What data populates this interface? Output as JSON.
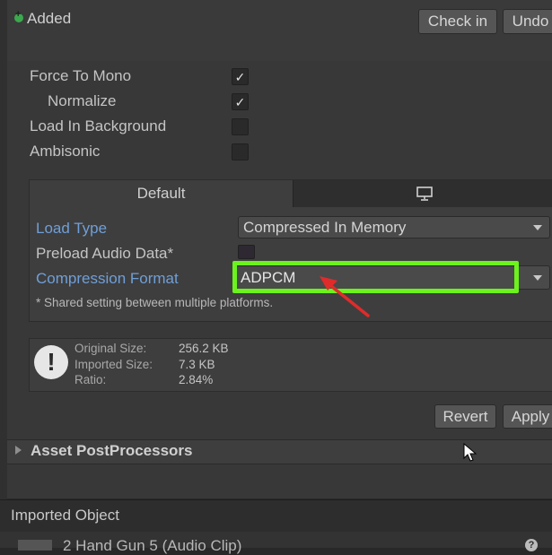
{
  "header": {
    "status_label": "Added",
    "checkin_label": "Check in",
    "undo_label": "Undo"
  },
  "properties": [
    {
      "label": "Force To Mono",
      "checked": true,
      "check_glyph": "✓"
    },
    {
      "label": "Normalize",
      "checked": true,
      "check_glyph": "✓"
    },
    {
      "label": "Load In Background",
      "checked": false,
      "check_glyph": ""
    },
    {
      "label": "Ambisonic",
      "checked": false,
      "check_glyph": ""
    }
  ],
  "platform_tabs": {
    "default_label": "Default",
    "second_tab_icon": "monitor-icon"
  },
  "platform_settings": {
    "load_type_label": "Load Type",
    "load_type_value": "Compressed In Memory",
    "preload_label": "Preload Audio Data*",
    "preload_checked": false,
    "compression_label": "Compression Format",
    "compression_value": "ADPCM",
    "shared_note": "* Shared setting between multiple platforms."
  },
  "info": {
    "icon": "warning-icon",
    "original_size_label": "Original Size:",
    "original_size_value": "256.2 KB",
    "imported_size_label": "Imported Size:",
    "imported_size_value": "7.3 KB",
    "ratio_label": "Ratio:",
    "ratio_value": "2.84%"
  },
  "actions": {
    "revert_label": "Revert",
    "apply_label": "Apply"
  },
  "sections": {
    "asset_postprocessors": "Asset PostProcessors",
    "imported_object": "Imported Object",
    "imported_row_text": "2 Hand Gun 5 (Audio Clip)"
  },
  "colors": {
    "highlight": "#6cf21c",
    "annotation_arrow": "#e02b2b",
    "blue_label": "#6f9fd8",
    "added_dot": "#3ca84e"
  }
}
